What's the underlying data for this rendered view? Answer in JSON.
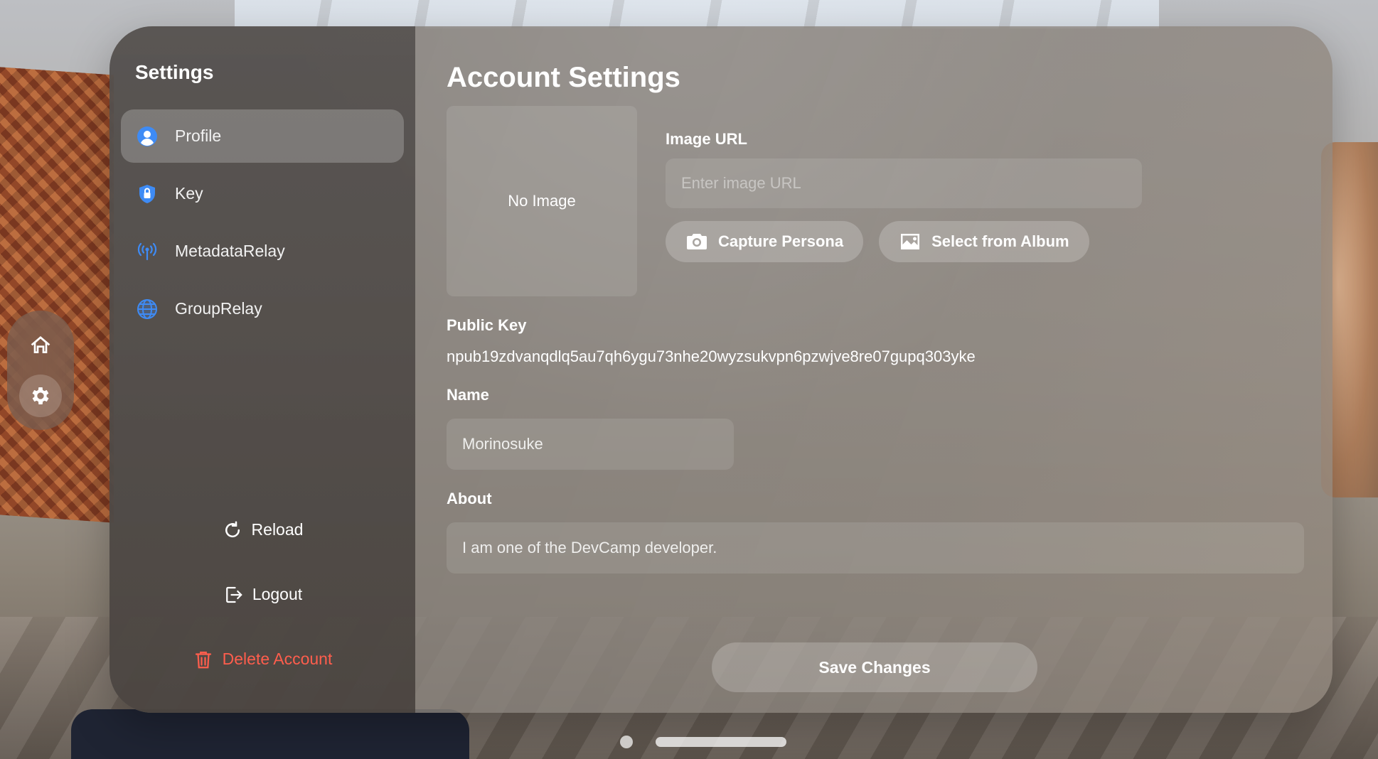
{
  "sidebar": {
    "title": "Settings",
    "items": [
      {
        "label": "Profile",
        "icon": "person-circle-icon",
        "active": true
      },
      {
        "label": "Key",
        "icon": "lock-shield-icon",
        "active": false
      },
      {
        "label": "MetadataRelay",
        "icon": "antenna-icon",
        "active": false
      },
      {
        "label": "GroupRelay",
        "icon": "globe-icon",
        "active": false
      }
    ],
    "actions": {
      "reload": "Reload",
      "logout": "Logout",
      "delete": "Delete Account"
    }
  },
  "ornament": {
    "items": [
      {
        "icon": "house-icon",
        "active": false
      },
      {
        "icon": "gear-icon",
        "active": true
      }
    ]
  },
  "main": {
    "title": "Account Settings",
    "photo_placeholder": "No Image",
    "image_url": {
      "label": "Image URL",
      "value": "",
      "placeholder": "Enter image URL"
    },
    "capture_button": "Capture Persona",
    "album_button": "Select from Album",
    "public_key": {
      "label": "Public Key",
      "value": "npub19zdvanqdlq5au7qh6ygu73nhe20wyzsukvpn6pzwjve8re07gupq303yke"
    },
    "name": {
      "label": "Name",
      "value": "Morinosuke"
    },
    "about": {
      "label": "About",
      "value": "I am one of the DevCamp developer."
    },
    "save_button": "Save Changes"
  },
  "colors": {
    "accent": "#3e8bf5",
    "danger": "#ff5e4d"
  }
}
